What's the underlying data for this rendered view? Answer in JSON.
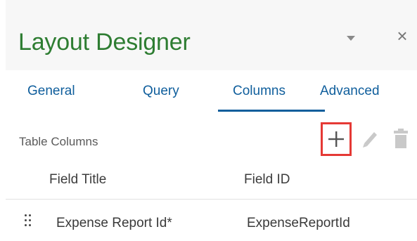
{
  "panel": {
    "title": "Layout Designer",
    "dropdown_icon": "chevron-down-icon",
    "close_label": "×"
  },
  "tabs": [
    {
      "label": "General"
    },
    {
      "label": "Query"
    },
    {
      "label": "Columns",
      "active": true
    },
    {
      "label": "Advanced"
    }
  ],
  "toolbar": {
    "label": "Table Columns",
    "add_icon": "plus-icon",
    "edit_icon": "pencil-icon",
    "delete_icon": "trash-icon",
    "highlight_color": "#e53935"
  },
  "table": {
    "headers": [
      "Field Title",
      "Field ID"
    ],
    "rows": [
      {
        "title": "Expense Report Id*",
        "id": "ExpenseReportId"
      }
    ]
  },
  "colors": {
    "title": "#2e7d32",
    "tab": "#0f5e9c",
    "header_bg": "#f7f7f7"
  }
}
